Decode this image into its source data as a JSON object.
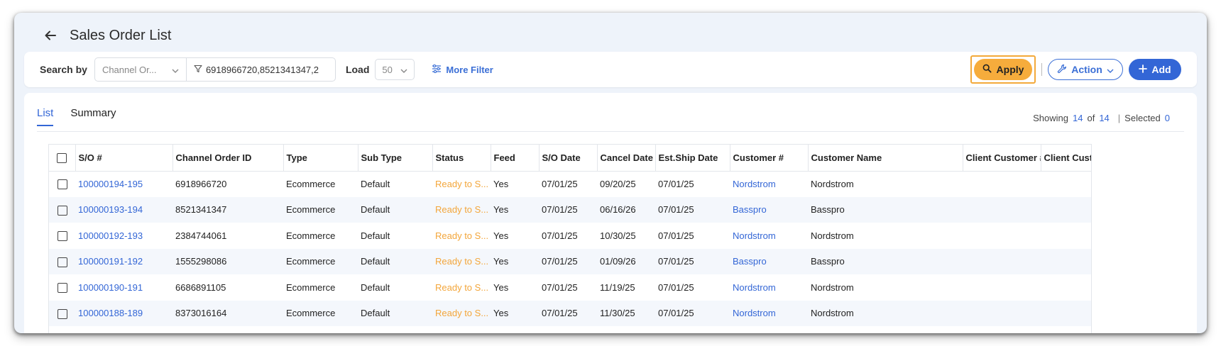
{
  "header": {
    "title": "Sales Order List"
  },
  "toolbar": {
    "search_by_label": "Search by",
    "channel_select_value": "Channel Or...",
    "filter_value": "6918966720,8521341347,2",
    "load_label": "Load",
    "load_value": "50",
    "more_filter_label": "More Filter",
    "apply_label": "Apply",
    "action_label": "Action",
    "add_label": "Add"
  },
  "tabs": [
    {
      "label": "List"
    },
    {
      "label": "Summary"
    }
  ],
  "summary": {
    "showing_label": "Showing",
    "showing_count": "14",
    "of_label": "of",
    "total_count": "14",
    "selected_label": "Selected",
    "selected_count": "0"
  },
  "table": {
    "columns": [
      "S/O #",
      "Channel Order ID",
      "Type",
      "Sub Type",
      "Status",
      "Feed",
      "S/O Date",
      "Cancel Date",
      "Est.Ship Date",
      "Customer #",
      "Customer Name",
      "Client Customer #",
      "Client Customer Name"
    ],
    "rows": [
      [
        "100000194-195",
        "6918966720",
        "Ecommerce",
        "Default",
        "Ready to S...",
        "Yes",
        "07/01/25",
        "09/20/25",
        "07/01/25",
        "Nordstrom",
        "Nordstrom"
      ],
      [
        "100000193-194",
        "8521341347",
        "Ecommerce",
        "Default",
        "Ready to S...",
        "Yes",
        "07/01/25",
        "06/16/26",
        "07/01/25",
        "Basspro",
        "Basspro"
      ],
      [
        "100000192-193",
        "2384744061",
        "Ecommerce",
        "Default",
        "Ready to S...",
        "Yes",
        "07/01/25",
        "10/30/25",
        "07/01/25",
        "Nordstrom",
        "Nordstrom"
      ],
      [
        "100000191-192",
        "1555298086",
        "Ecommerce",
        "Default",
        "Ready to S...",
        "Yes",
        "07/01/25",
        "01/09/26",
        "07/01/25",
        "Basspro",
        "Basspro"
      ],
      [
        "100000190-191",
        "6686891105",
        "Ecommerce",
        "Default",
        "Ready to S...",
        "Yes",
        "07/01/25",
        "11/19/25",
        "07/01/25",
        "Nordstrom",
        "Nordstrom"
      ],
      [
        "100000188-189",
        "8373016164",
        "Ecommerce",
        "Default",
        "Ready to S...",
        "Yes",
        "07/01/25",
        "11/30/25",
        "07/01/25",
        "Nordstrom",
        "Nordstrom"
      ]
    ]
  },
  "colors": {
    "accent": "#3366d6",
    "apply": "#f6ac3c",
    "status": "#f3a63b"
  },
  "icons": [
    "back-arrow-icon",
    "chevron-down-icon",
    "filter-icon",
    "sliders-icon",
    "search-icon",
    "wrench-icon",
    "plus-icon"
  ]
}
